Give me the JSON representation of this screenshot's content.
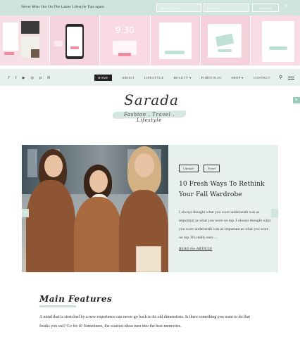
{
  "notify": {
    "message": "Never Miss Out On The Latest Lifestyle Tips again",
    "name_placeholder": "Your first Name",
    "email_placeholder": "Your Email",
    "subscribe_label": "Subscribe",
    "close": "×"
  },
  "insta": {
    "clock": "9:30"
  },
  "nav": {
    "social": [
      "f",
      "t",
      "▶",
      "◎",
      "p",
      "✉"
    ],
    "menu": [
      {
        "label": "HOME",
        "active": true
      },
      {
        "label": "ABOUT"
      },
      {
        "label": "LIFESTYLE"
      },
      {
        "label": "BEAUTY ▾"
      },
      {
        "label": "PORTFOLIO"
      },
      {
        "label": "SHOP ▾"
      },
      {
        "label": "CONTACT"
      }
    ],
    "search_icon": "⚲",
    "side_tab": "▸"
  },
  "logo": {
    "name": "Sarada",
    "tagline": "Fashion . Travel . Lifestyle"
  },
  "hero": {
    "categories": [
      "Lifestyle",
      "Travel"
    ],
    "title": "10 Fresh Ways To Rethink Your Fall Wardrobe",
    "excerpt": "I always thought what you wore underneath was as important as what you wore on top. I always thought what you wore underneath was as important as what you wore on top. It's really easy ...",
    "read_more": "READ the ARTICLE",
    "prev": "‹",
    "next": "›"
  },
  "features": {
    "title": "Main Features",
    "text": "A mind that is stretched by a new experience can never go back to its old dimensions. Is there something you want to do that freaks you out? Go for it! Sometimes, the scariest ideas turn into the best memories."
  },
  "colors": {
    "mint": "#cfe4dd",
    "mint_light": "#e7f0ed",
    "pink": "#f7d6e0",
    "accent_pink": "#f08ca0",
    "text": "#333333"
  }
}
